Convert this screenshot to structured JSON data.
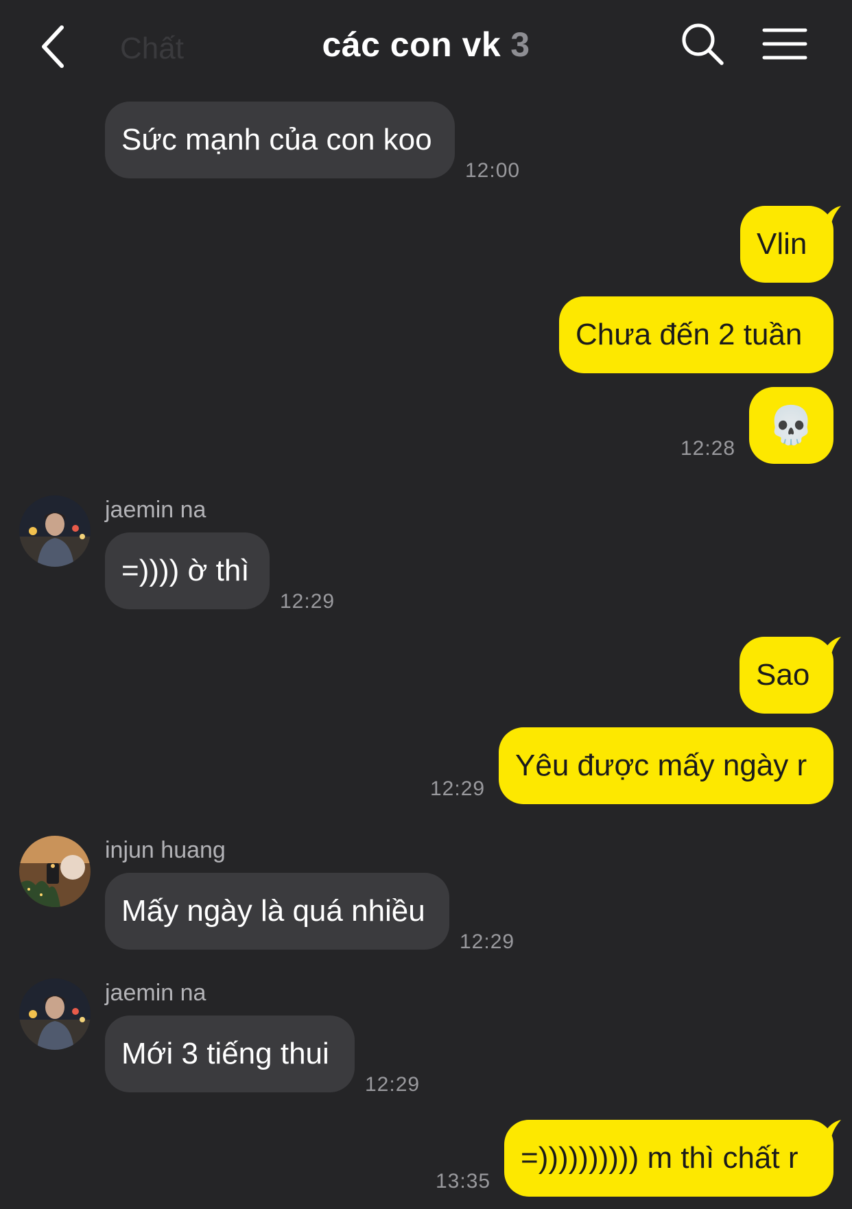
{
  "header": {
    "title": "các con vk",
    "member_count": "3",
    "ghost_text": "Chất",
    "back_icon": "chevron-left-icon",
    "search_icon": "search-icon",
    "menu_icon": "hamburger-menu-icon"
  },
  "colors": {
    "background": "#252527",
    "incoming_bubble": "#3b3b3e",
    "outgoing_bubble": "#fde800",
    "timestamp": "#9a9a9e"
  },
  "messages": [
    {
      "text": "Sức mạnh của con koo",
      "time": "12:00"
    },
    {
      "text": "Vlin"
    },
    {
      "text": "Chưa đến 2 tuần"
    },
    {
      "text": "💀",
      "time": "12:28"
    },
    {
      "sender": "jaemin na",
      "text": "=)))) ờ thì",
      "time": "12:29"
    },
    {
      "text": "Sao"
    },
    {
      "text": "Yêu được mấy ngày r",
      "time": "12:29"
    },
    {
      "sender": "injun huang",
      "text": "Mấy ngày là quá nhiều",
      "time": "12:29"
    },
    {
      "sender": "jaemin na",
      "text": "Mới 3 tiếng thui",
      "time": "12:29"
    },
    {
      "text": "=)))))))))) m thì chất r",
      "time": "13:35"
    }
  ]
}
